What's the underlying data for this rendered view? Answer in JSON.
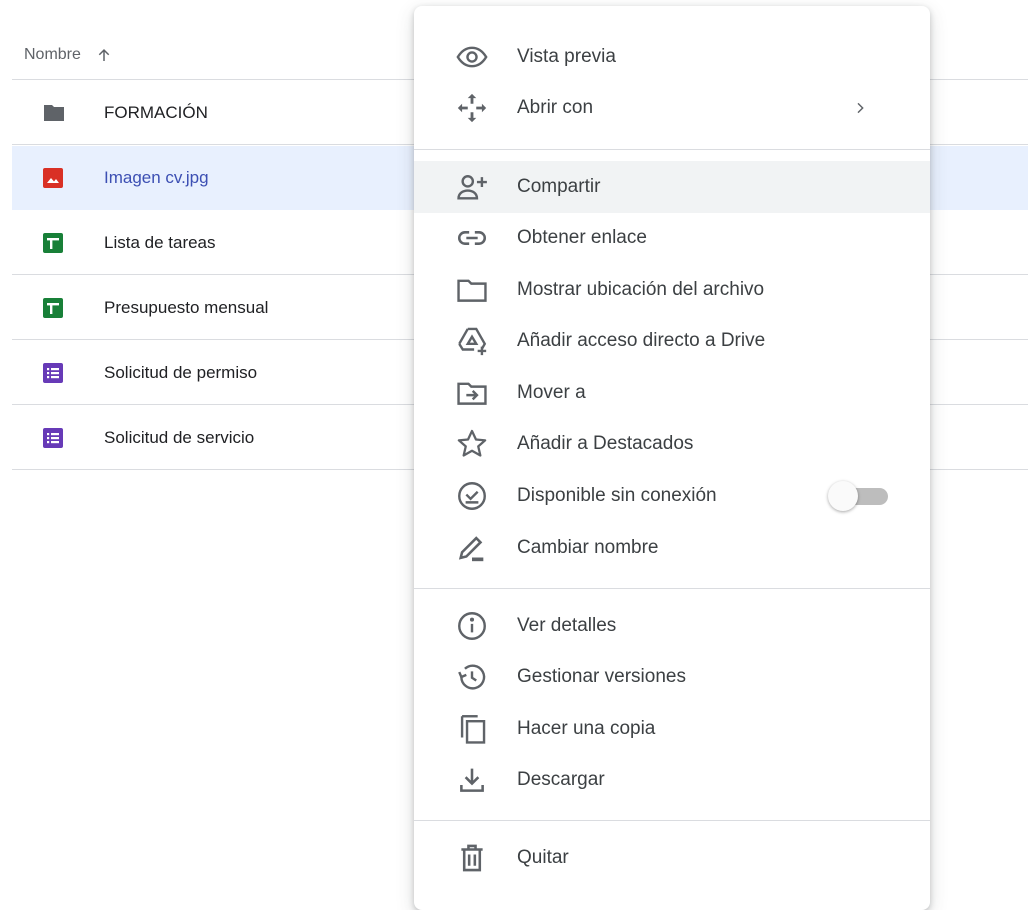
{
  "list": {
    "header": {
      "name_label": "Nombre"
    },
    "files": [
      {
        "name": "FORMACIÓN",
        "type": "folder"
      },
      {
        "name": "Imagen cv.jpg",
        "type": "image",
        "selected": true
      },
      {
        "name": "Lista de tareas",
        "type": "sheet"
      },
      {
        "name": "Presupuesto mensual",
        "type": "sheet"
      },
      {
        "name": "Solicitud de permiso",
        "type": "form"
      },
      {
        "name": "Solicitud de servicio",
        "type": "form"
      }
    ]
  },
  "menu": {
    "items": [
      {
        "label": "Vista previa",
        "icon": "eye-icon"
      },
      {
        "label": "Abrir con",
        "icon": "open-with-icon",
        "submenu": true
      },
      {
        "label": "Compartir",
        "icon": "add-person-icon",
        "highlighted": true
      },
      {
        "label": "Obtener enlace",
        "icon": "link-icon"
      },
      {
        "label": "Mostrar ubicación del archivo",
        "icon": "folder-outline-icon"
      },
      {
        "label": "Añadir acceso directo a Drive",
        "icon": "drive-shortcut-icon"
      },
      {
        "label": "Mover a",
        "icon": "move-to-folder-icon"
      },
      {
        "label": "Añadir a Destacados",
        "icon": "star-icon"
      },
      {
        "label": "Disponible sin conexión",
        "icon": "offline-check-icon",
        "toggle": false
      },
      {
        "label": "Cambiar nombre",
        "icon": "pencil-icon"
      },
      {
        "label": "Ver detalles",
        "icon": "info-icon"
      },
      {
        "label": "Gestionar versiones",
        "icon": "history-icon"
      },
      {
        "label": "Hacer una copia",
        "icon": "copy-icon"
      },
      {
        "label": "Descargar",
        "icon": "download-icon"
      },
      {
        "label": "Quitar",
        "icon": "trash-icon"
      }
    ]
  },
  "colors": {
    "selected_row_bg": "#e8f0fe",
    "selected_text": "#3c4fb3",
    "folder": "#5f6368",
    "image_red": "#d93025",
    "sheet_green": "#188038",
    "form_purple": "#673ab7",
    "menu_hover": "#f1f3f4"
  }
}
